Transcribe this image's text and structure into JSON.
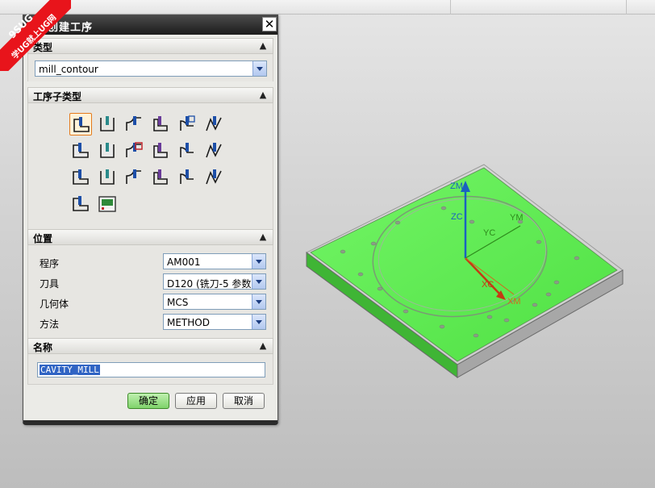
{
  "dialog": {
    "title": "创建工序",
    "close_glyph": "✕",
    "sections": {
      "type": {
        "label": "类型",
        "value": "mill_contour"
      },
      "subtype": {
        "label": "工序子类型",
        "icons": [
          "cavity-mill-icon",
          "plunge-milling-icon",
          "corner-rough-icon",
          "rest-milling-icon",
          "zlevel-profile-icon",
          "zlevel-corner-icon",
          "fixed-contour-icon",
          "contour-area-icon",
          "contour-surface-area-icon",
          "streamline-icon",
          "contour-area-non-steep-icon",
          "contour-area-dir-steep-icon",
          "flowcut-single-icon",
          "flowcut-multiple-icon",
          "flowcut-ref-tool-icon",
          "flowcut-smooth-icon",
          "solid-profile-3d-icon",
          "contour-text-icon",
          "mill-user-icon",
          "mill-control-icon"
        ]
      },
      "location": {
        "label": "位置",
        "rows": [
          {
            "label": "程序",
            "value": "AM001"
          },
          {
            "label": "刀具",
            "value": "D120 (铣刀-5 参数"
          },
          {
            "label": "几何体",
            "value": "MCS"
          },
          {
            "label": "方法",
            "value": "METHOD"
          }
        ]
      },
      "name": {
        "label": "名称",
        "value": "CAVITY_MILL"
      }
    },
    "buttons": {
      "ok": "确定",
      "apply": "应用",
      "cancel": "取消"
    }
  },
  "viewport": {
    "axes": {
      "zm": "ZM",
      "zc": "ZC",
      "ym": "YM",
      "yc": "YC",
      "xc": "XC",
      "xm": "XM"
    }
  },
  "watermark": {
    "line1": "9SUG",
    "line2": "学UG就上UG网"
  },
  "colors": {
    "part_top": "#5ef052",
    "part_side": "#3fb535",
    "dialog_bg": "#ebebe7",
    "ok_button": "#8fdc7a",
    "selection": "#3064c4",
    "watermark": "#e8141b"
  }
}
